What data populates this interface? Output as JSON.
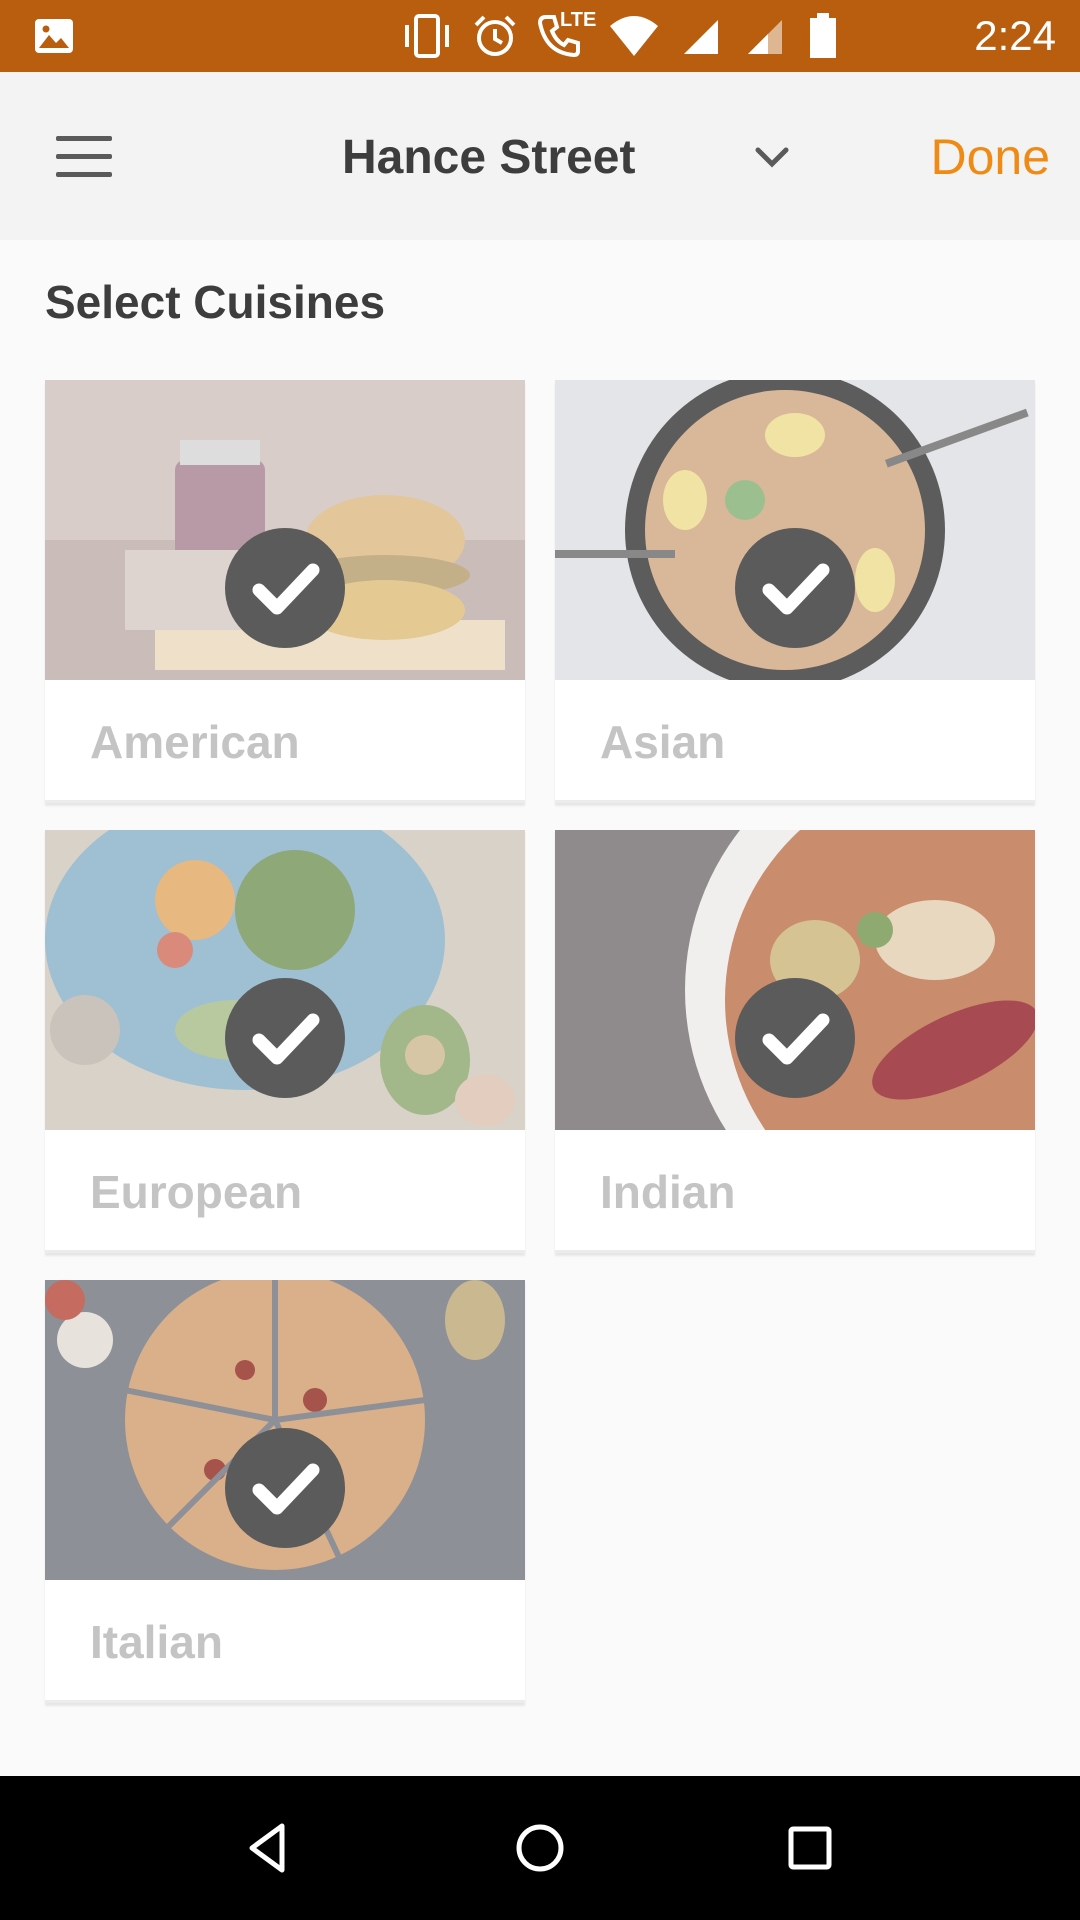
{
  "status_bar": {
    "time": "2:24",
    "icons": [
      "image-icon",
      "vibrate-icon",
      "alarm-icon",
      "lte-call-icon",
      "wifi-icon",
      "signal-icon",
      "signal-icon",
      "battery-icon"
    ],
    "lte_label": "LTE",
    "background": "#b85e0e"
  },
  "app_bar": {
    "location": "Hance Street",
    "done_label": "Done",
    "accent": "#ef8a14"
  },
  "section_title": "Select Cuisines",
  "cuisines": [
    {
      "label": "American",
      "selected": true
    },
    {
      "label": "Asian",
      "selected": true
    },
    {
      "label": "European",
      "selected": true
    },
    {
      "label": "Indian",
      "selected": true
    },
    {
      "label": "Italian",
      "selected": true
    }
  ]
}
